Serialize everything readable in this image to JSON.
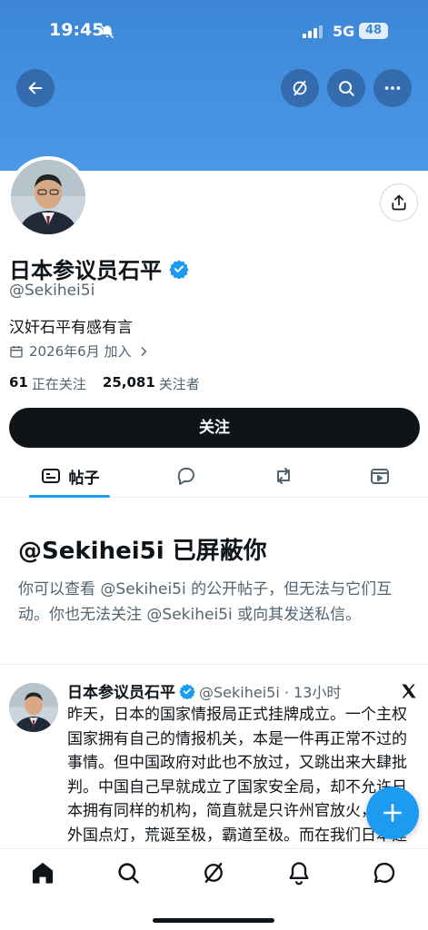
{
  "status_bar": {
    "time": "19:45",
    "network": "5G",
    "battery": "48"
  },
  "profile": {
    "display_name": "日本参议员石平",
    "handle": "@Sekihei5i",
    "bio": "汉奸石平有感有言",
    "joined": "2026年6月 加入",
    "following_count": "61",
    "following_label": "正在关注",
    "followers_count": "25,081",
    "followers_label": "关注者",
    "follow_button": "关注"
  },
  "tabs": {
    "posts_label": "帖子"
  },
  "blocked_notice": {
    "title": "@Sekihei5i 已屏蔽你",
    "description": "你可以查看 @Sekihei5i 的公开帖子，但无法与它们互动。你也无法关注 @Sekihei5i 或向其发送私信。"
  },
  "tweet": {
    "author": "日本参议员石平",
    "meta": "@Sekihei5i · 13小时",
    "text": "昨天，日本的国家情报局正式挂牌成立。一个主权国家拥有自己的情报机关，本是一件再正常不过的事情。但中国政府对此也不放过，又跳出来大肆批判。中国自己早就成立了国家安全局，却不允许日本拥有同样的机构，简直就是只许州官放火，不许外国点灯，荒诞至极，霸道至极。而在我们日本建立自己的国家机构，既不需要中国"
  },
  "colors": {
    "banner": "#4b98e8",
    "accent": "#1d9bf0",
    "text_primary": "#0f1419",
    "text_secondary": "#536471"
  },
  "icons": {
    "back": "arrow-left-icon",
    "grok": "grok-icon",
    "search": "search-icon",
    "more": "more-horizontal-icon",
    "share": "share-icon",
    "verified": "verified-badge-icon",
    "calendar": "calendar-icon",
    "posts_tab": "posts-tab-icon",
    "replies_tab": "reply-bubble-icon",
    "reposts_tab": "repost-icon",
    "media_tab": "video-icon",
    "compose": "plus-icon",
    "nav_home": "home-icon",
    "nav_search": "search-icon",
    "nav_grok": "grok-icon",
    "nav_notifications": "bell-icon",
    "nav_messages": "message-icon"
  }
}
